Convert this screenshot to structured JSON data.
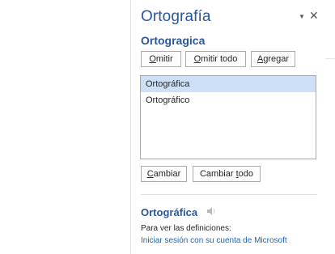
{
  "pane": {
    "title": "Ortografía",
    "menu_icon": "triangle-down-icon",
    "close_icon": "close-icon"
  },
  "misspelled_word": "Ortogragica",
  "buttons": {
    "omitir": {
      "accel": "O",
      "rest": "mitir"
    },
    "omitir_todo": {
      "accel": "O",
      "rest": "mitir todo"
    },
    "agregar": {
      "accel": "A",
      "rest": "gregar"
    },
    "cambiar": {
      "accel": "C",
      "rest": "ambiar"
    },
    "cambiar_todo": {
      "before": "Cambiar ",
      "accel": "t",
      "rest": "odo"
    }
  },
  "suggestions": [
    {
      "label": "Ortográfica",
      "selected": true
    },
    {
      "label": "Ortográfico",
      "selected": false
    }
  ],
  "dictionary": {
    "word": "Ortográfica",
    "speaker_icon": "speaker-icon",
    "definition_prompt": "Para ver las definiciones:",
    "signin_link": "Iniciar sesión con su cuenta de Microsoft"
  },
  "colors": {
    "accent": "#2b579a",
    "link": "#1b66b1",
    "selection": "#cde0f7"
  }
}
